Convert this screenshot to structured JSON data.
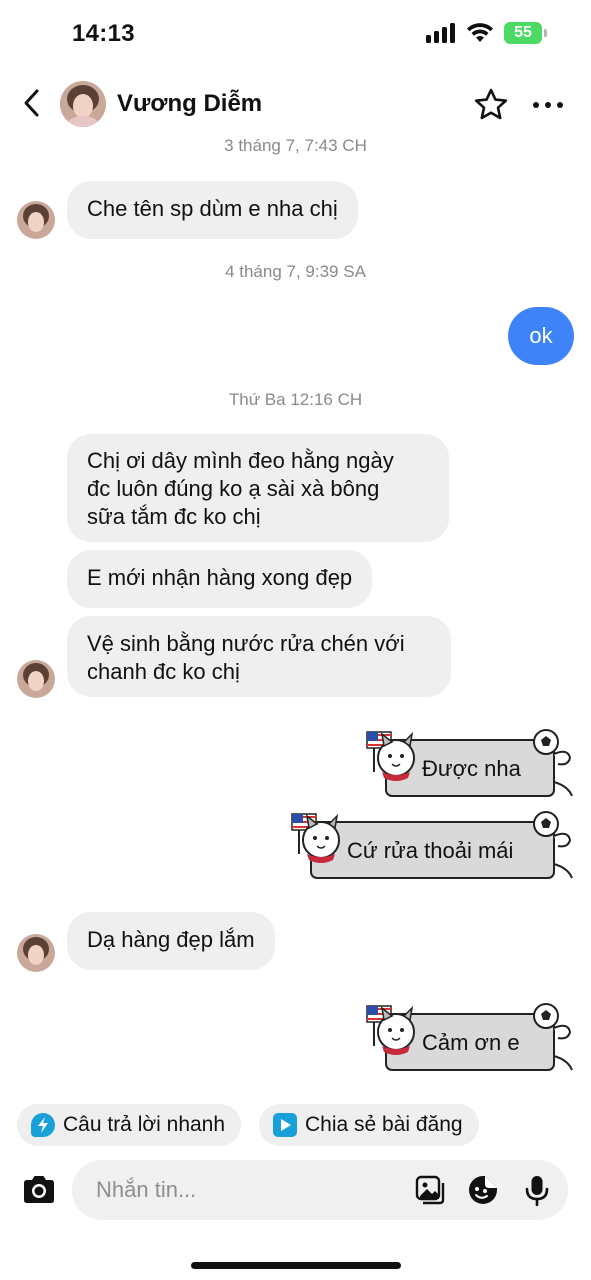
{
  "status_bar": {
    "time": "14:13",
    "battery": "55"
  },
  "header": {
    "contact_name": "Vương Diễm",
    "back_icon": "chevron-left-icon",
    "star_icon": "star-icon",
    "more_icon": "more-icon"
  },
  "messages": {
    "ts1": "3 tháng 7, 7:43 CH",
    "m1": "Che tên sp dùm e nha chị",
    "ts2": "4 tháng 7, 9:39 SA",
    "m2": "ok",
    "ts3": "Thứ Ba 12:16 CH",
    "m3_line1": "Chị ơi dây mình đeo hằng ngày",
    "m3_line2": "đc luôn đúng ko ạ sài xà bông",
    "m3_line3": "sữa tắm đc ko chị",
    "m4": "E mới nhận hàng xong đẹp",
    "m5_line1": "Vệ sinh bằng nước rửa chén với",
    "m5_line2": "chanh đc ko chị",
    "s1": "Được nha",
    "s2": "Cứ rửa thoải mái",
    "m6": "Dạ hàng đẹp lắm",
    "s3": "Cảm ơn e"
  },
  "quick_actions": {
    "quick_reply": "Câu trả lời nhanh",
    "share_post": "Chia sẻ bài đăng"
  },
  "composer": {
    "placeholder": "Nhắn tin..."
  },
  "colors": {
    "outgoing": "#3e83f8",
    "incoming": "#efefef",
    "battery": "#4cd964"
  }
}
